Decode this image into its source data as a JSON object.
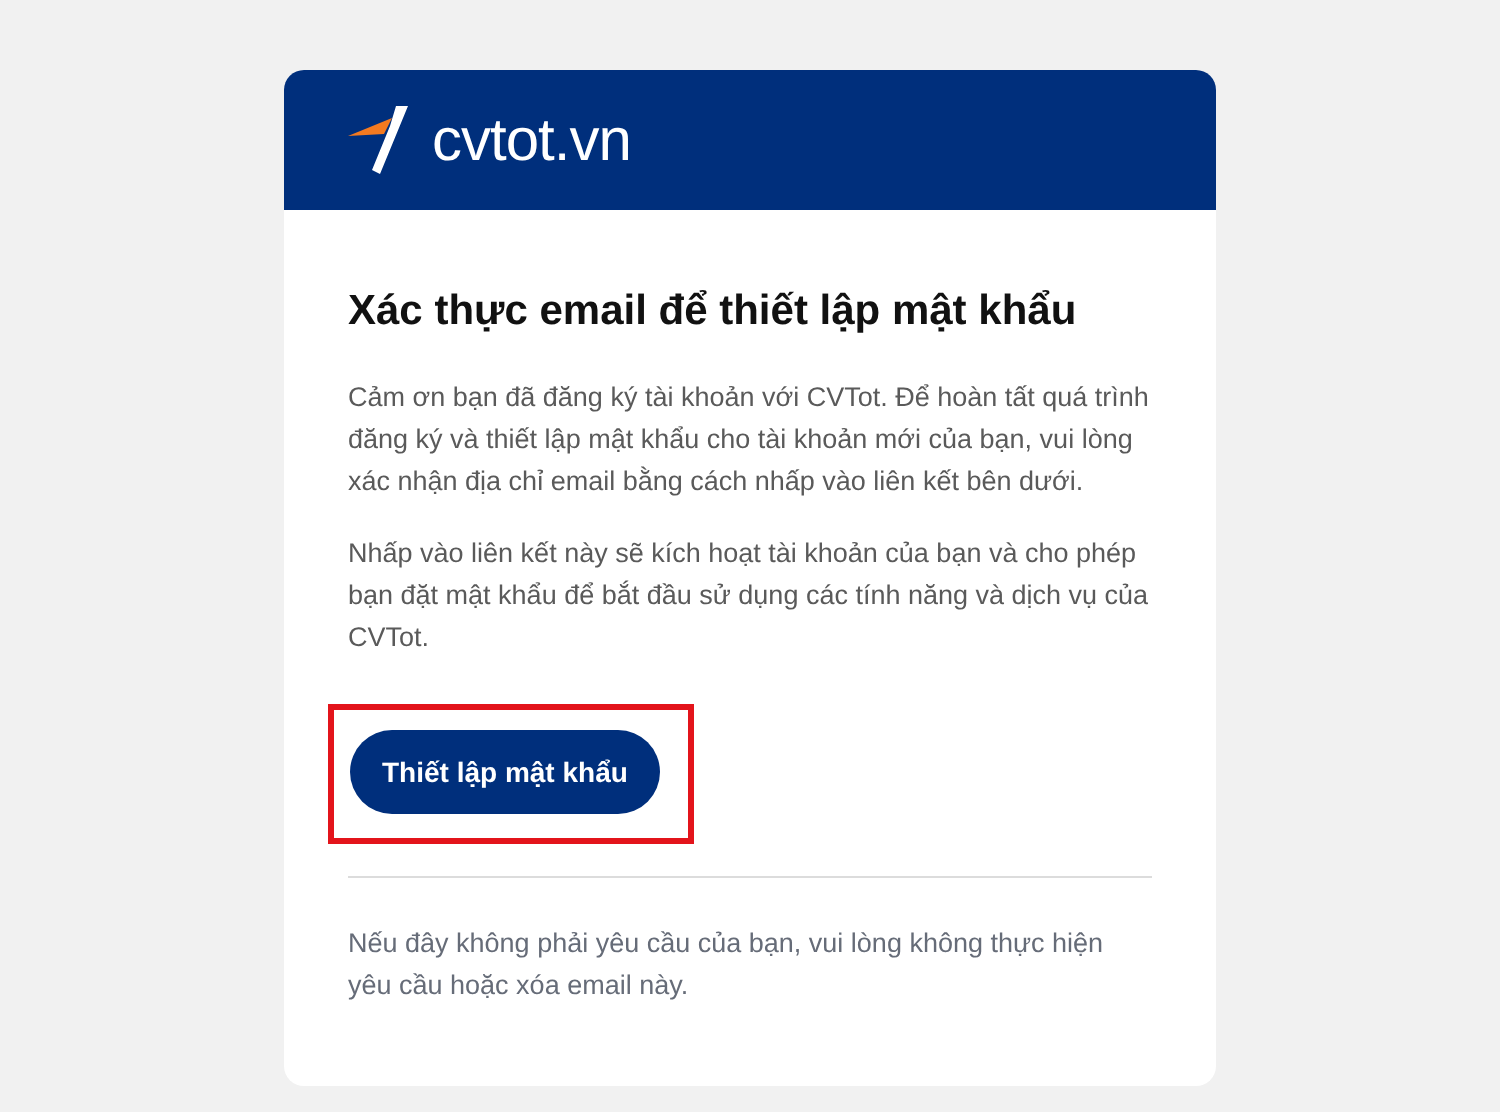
{
  "logo": {
    "text": "cvtot.vn"
  },
  "title": "Xác thực email để thiết lập mật khẩu",
  "paragraphs": [
    "Cảm ơn bạn đã đăng ký tài khoản với CVTot. Để hoàn tất quá trình đăng ký và thiết lập mật khẩu cho tài khoản mới của bạn, vui lòng xác nhận địa chỉ email bằng cách nhấp vào liên kết bên dưới.",
    "Nhấp vào liên kết này sẽ kích hoạt tài khoản của bạn và cho phép bạn đặt mật khẩu để bắt đầu sử dụng các tính năng và dịch vụ của CVTot."
  ],
  "button": {
    "label": "Thiết lập mật khẩu",
    "highlighted": true
  },
  "footer_note": "Nếu đây không phải yêu cầu của bạn, vui lòng không thực hiện yêu cầu hoặc xóa email này."
}
